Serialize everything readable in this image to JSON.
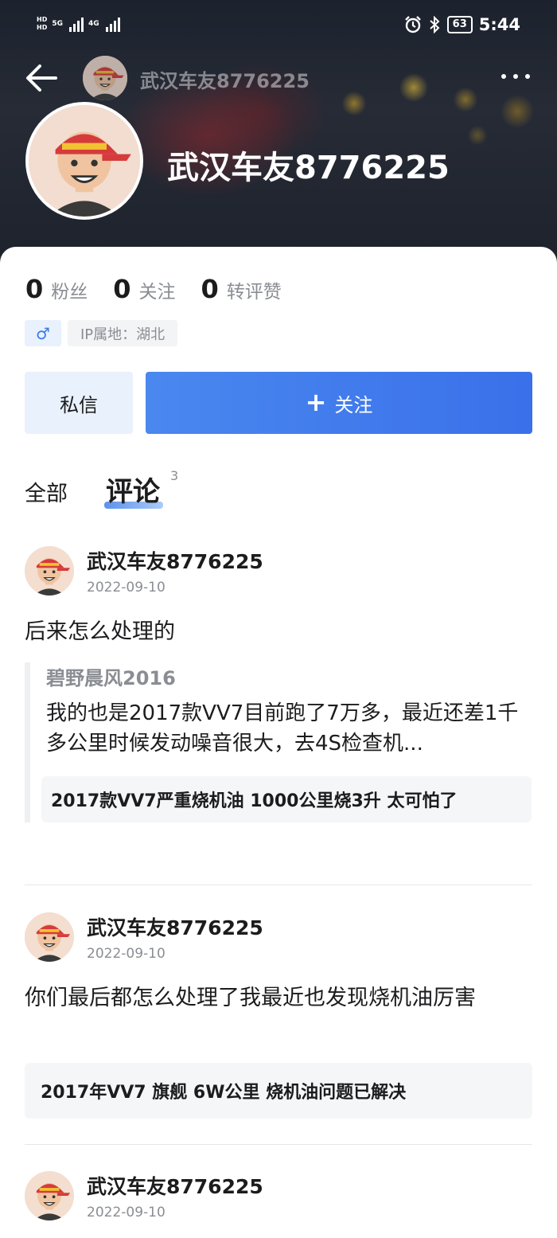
{
  "status_bar": {
    "hd1": "HD",
    "hd2": "HD",
    "net1": "5G",
    "net2": "4G",
    "battery": "63",
    "time": "5:44"
  },
  "nav": {
    "title": "武汉车友8776225"
  },
  "profile": {
    "name": "武汉车友8776225",
    "stats": [
      {
        "num": "0",
        "label": "粉丝"
      },
      {
        "num": "0",
        "label": "关注"
      },
      {
        "num": "0",
        "label": "转评赞"
      }
    ],
    "gender_symbol": "♂",
    "ip_label": "IP属地：湖北"
  },
  "actions": {
    "message_label": "私信",
    "follow_icon": "+",
    "follow_label": "关注"
  },
  "tabs": {
    "all_label": "全部",
    "comments_label": "评论",
    "comments_count": "3"
  },
  "comments": [
    {
      "author": "武汉车友8776225",
      "date": "2022-09-10",
      "text": "后来怎么处理的",
      "quote_author": "碧野晨风2016",
      "quote_text": "我的也是2017款VV7目前跑了7万多，最近还差1千多公里时候发动噪音很大，去4S检查机...",
      "topic": "2017款VV7严重烧机油 1000公里烧3升 太可怕了"
    },
    {
      "author": "武汉车友8776225",
      "date": "2022-09-10",
      "text": "你们最后都怎么处理了我最近也发现烧机油厉害",
      "topic": "2017年VV7 旗舰 6W公里 烧机油问题已解决"
    },
    {
      "author": "武汉车友8776225",
      "date": "2022-09-10"
    }
  ],
  "colors": {
    "accent": "#3f7ef0",
    "muted": "#8a8d93",
    "avatar_cap": "#d63b3b",
    "avatar_skin": "#f0c4a0"
  },
  "icons": {
    "back": "arrow-left-icon",
    "more": "more-horizontal-icon",
    "alarm": "alarm-icon",
    "bluetooth": "bluetooth-icon"
  }
}
